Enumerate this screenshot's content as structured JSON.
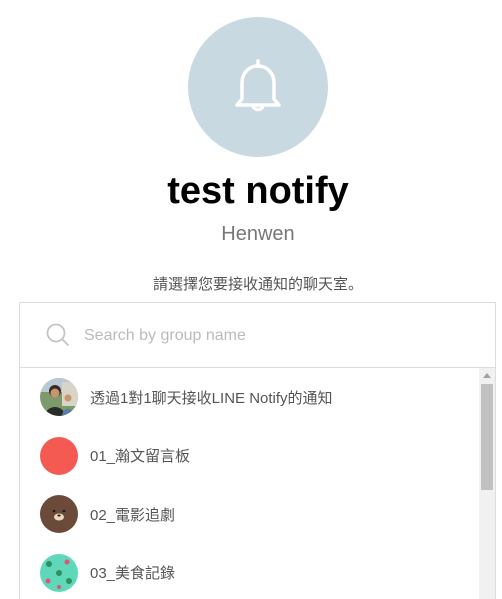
{
  "service": {
    "icon": "bell-icon",
    "icon_bg_color": "#c9d9e2",
    "name": "test notify",
    "owner": "Henwen"
  },
  "instruction": "請選擇您要接收通知的聊天室。",
  "search": {
    "icon": "search-icon",
    "placeholder": "Search by group name",
    "value": ""
  },
  "chat_rooms": [
    {
      "label": "透過1對1聊天接收LINE Notify的通知",
      "avatar": "user-photo-avatar"
    },
    {
      "label": "01_瀚文留言板",
      "avatar": "red-circle-avatar",
      "color": "#f45a52"
    },
    {
      "label": "02_電影追劇",
      "avatar": "brown-character-avatar",
      "color": "#6b4a3a"
    },
    {
      "label": "03_美食記錄",
      "avatar": "mint-pattern-avatar",
      "color": "#5fd8b9"
    }
  ]
}
